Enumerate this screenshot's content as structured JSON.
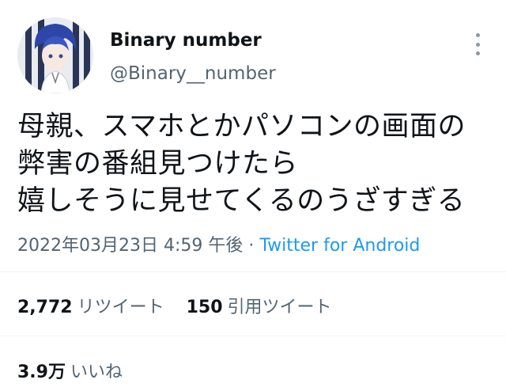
{
  "user": {
    "display_name": "Binary number",
    "handle": "@Binary__number",
    "avatar_icon": "user-avatar-icon"
  },
  "tweet": {
    "lines": [
      "母親、スマホとかパソコンの画面の",
      "弊害の番組見つけたら",
      "嬉しそうに見せてくるのうざすぎる"
    ]
  },
  "meta": {
    "timestamp": "2022年03月23日 4:59 午後",
    "separator": " · ",
    "source": "Twitter for Android"
  },
  "stats": {
    "retweets_count": "2,772",
    "retweets_label": "リツイート",
    "quotes_count": "150",
    "quotes_label": "引用ツイート",
    "likes_count": "3.9万",
    "likes_label": "いいね"
  },
  "colors": {
    "text": "#0f1419",
    "secondary": "#536471",
    "link": "#1d9bf0",
    "divider": "#eff3f4"
  },
  "icons": {
    "more": "more-options-icon"
  }
}
